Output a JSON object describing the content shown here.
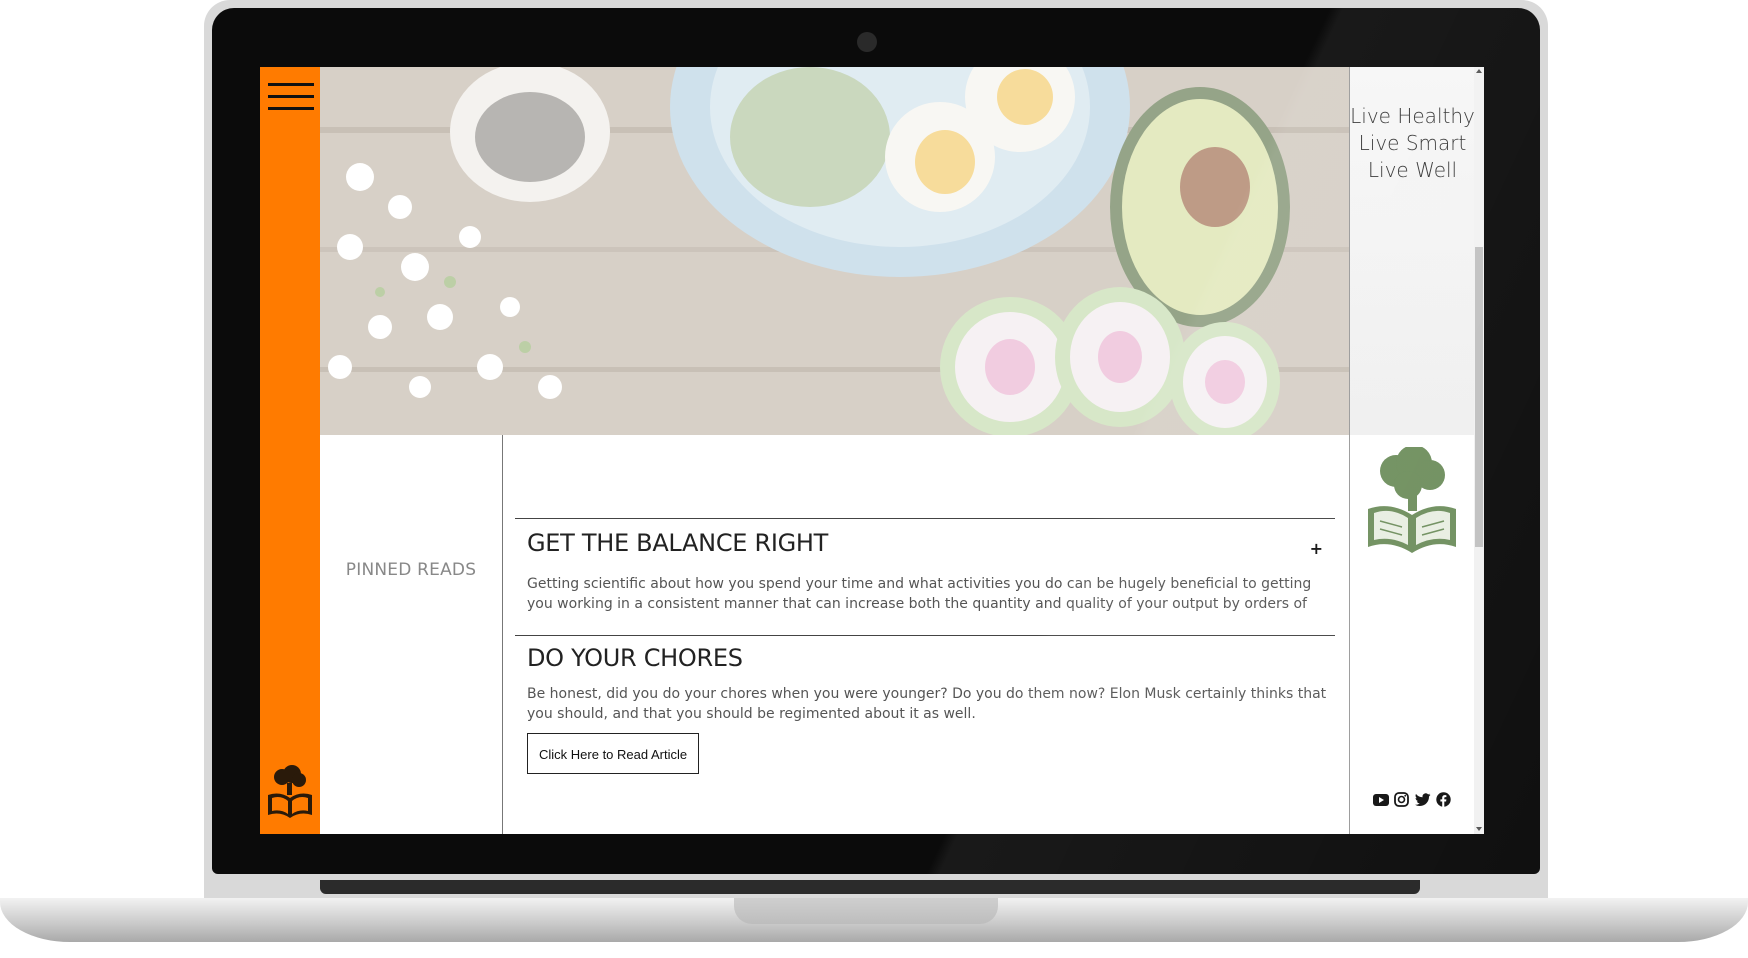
{
  "header": {
    "tagline": [
      "Live Healthy",
      "Live Smart",
      "Live Well"
    ]
  },
  "sidebar": {
    "pinned_label": "PINNED READS"
  },
  "articles": [
    {
      "title": "GET THE BALANCE RIGHT",
      "toggle": "+",
      "excerpt": "Getting scientific about how you spend your time and what activities you do can be hugely beneficial to getting you working in a consistent manner that can increase both the quantity and quality of your output by orders of magnitude...."
    },
    {
      "title": "DO YOUR CHORES",
      "excerpt": "Be honest, did you do your chores when you were younger? Do you do them now? Elon Musk certainly thinks that you should, and that you should be regimented about it as well.",
      "button_label": "Click Here to Read Article"
    }
  ],
  "social": [
    "youtube-icon",
    "instagram-icon",
    "twitter-icon",
    "facebook-icon"
  ],
  "colors": {
    "accent": "#ff7b00",
    "logo_green": "#6f8f5e"
  }
}
